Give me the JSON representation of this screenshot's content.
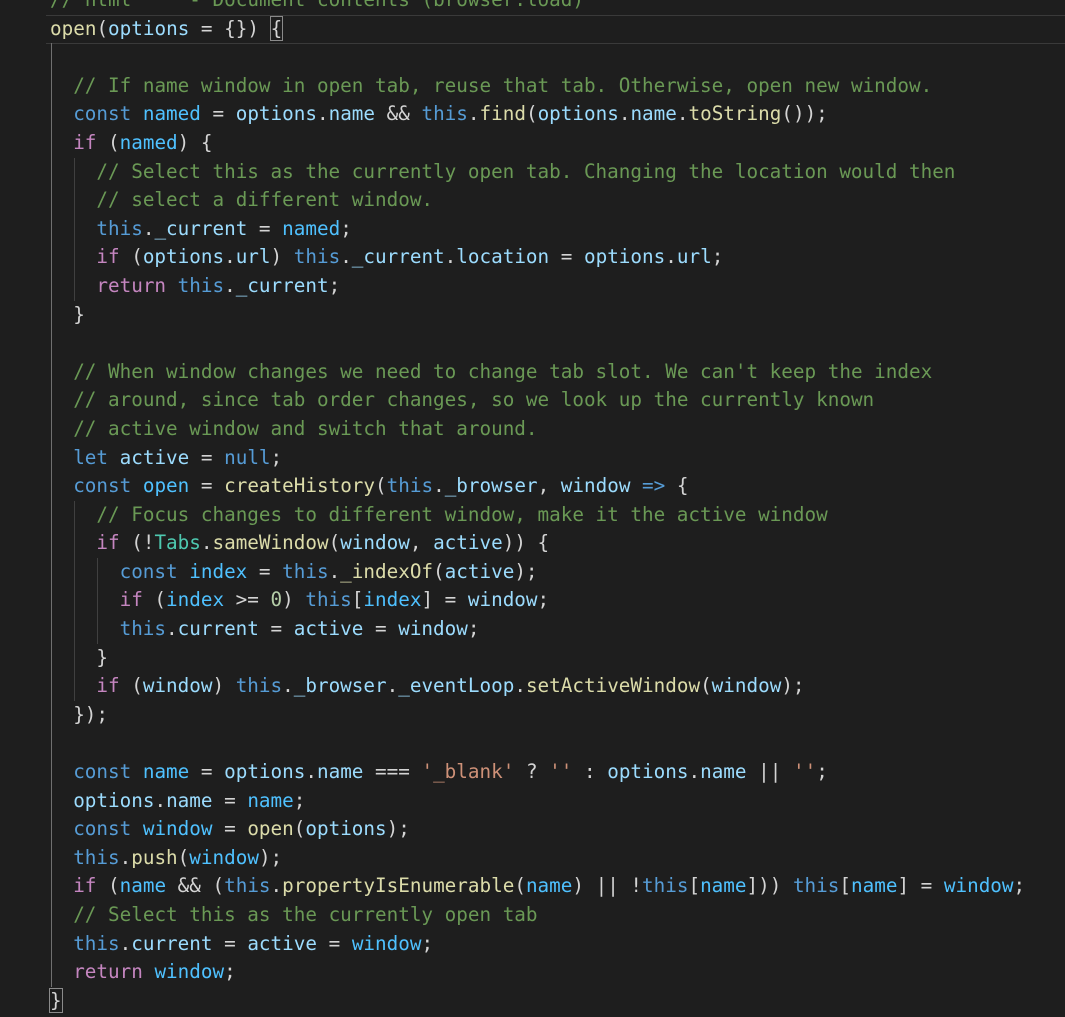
{
  "colors": {
    "background": "#1e1e1e",
    "default": "#d4d4d4",
    "comment": "#6a9955",
    "keyword": "#569cd6",
    "control": "#c586c0",
    "variable": "#9cdcfe",
    "function": "#dcdcaa",
    "string": "#ce9178",
    "number": "#b5cea8",
    "class": "#4ec9b0",
    "constant": "#4fc1ff"
  },
  "code": {
    "lines": [
      {
        "indent": 0,
        "tokens": [
          [
            "c",
            "// html     - Document contents (browser.load)"
          ]
        ]
      },
      {
        "indent": 0,
        "tokens": [
          [
            "f",
            "open"
          ],
          [
            "d",
            "("
          ],
          [
            "v",
            "options"
          ],
          [
            "d",
            " = {}) "
          ],
          [
            "d",
            "{"
          ]
        ]
      },
      {
        "indent": 1,
        "tokens": []
      },
      {
        "indent": 1,
        "tokens": [
          [
            "c",
            "// If name window in open tab, reuse that tab. Otherwise, open new window."
          ]
        ]
      },
      {
        "indent": 1,
        "tokens": [
          [
            "k",
            "const"
          ],
          [
            "d",
            " "
          ],
          [
            "n",
            "named"
          ],
          [
            "d",
            " = "
          ],
          [
            "v",
            "options"
          ],
          [
            "d",
            "."
          ],
          [
            "v",
            "name"
          ],
          [
            "d",
            " && "
          ],
          [
            "k",
            "this"
          ],
          [
            "d",
            "."
          ],
          [
            "f",
            "find"
          ],
          [
            "d",
            "("
          ],
          [
            "v",
            "options"
          ],
          [
            "d",
            "."
          ],
          [
            "v",
            "name"
          ],
          [
            "d",
            "."
          ],
          [
            "f",
            "toString"
          ],
          [
            "d",
            "());"
          ]
        ]
      },
      {
        "indent": 1,
        "tokens": [
          [
            "p",
            "if"
          ],
          [
            "d",
            " ("
          ],
          [
            "n",
            "named"
          ],
          [
            "d",
            ") {"
          ]
        ]
      },
      {
        "indent": 2,
        "tokens": [
          [
            "c",
            "// Select this as the currently open tab. Changing the location would then"
          ]
        ]
      },
      {
        "indent": 2,
        "tokens": [
          [
            "c",
            "// select a different window."
          ]
        ]
      },
      {
        "indent": 2,
        "tokens": [
          [
            "k",
            "this"
          ],
          [
            "d",
            "."
          ],
          [
            "v",
            "_current"
          ],
          [
            "d",
            " = "
          ],
          [
            "n",
            "named"
          ],
          [
            "d",
            ";"
          ]
        ]
      },
      {
        "indent": 2,
        "tokens": [
          [
            "p",
            "if"
          ],
          [
            "d",
            " ("
          ],
          [
            "v",
            "options"
          ],
          [
            "d",
            "."
          ],
          [
            "v",
            "url"
          ],
          [
            "d",
            ") "
          ],
          [
            "k",
            "this"
          ],
          [
            "d",
            "."
          ],
          [
            "v",
            "_current"
          ],
          [
            "d",
            "."
          ],
          [
            "v",
            "location"
          ],
          [
            "d",
            " = "
          ],
          [
            "v",
            "options"
          ],
          [
            "d",
            "."
          ],
          [
            "v",
            "url"
          ],
          [
            "d",
            ";"
          ]
        ]
      },
      {
        "indent": 2,
        "tokens": [
          [
            "p",
            "return"
          ],
          [
            "d",
            " "
          ],
          [
            "k",
            "this"
          ],
          [
            "d",
            "."
          ],
          [
            "v",
            "_current"
          ],
          [
            "d",
            ";"
          ]
        ]
      },
      {
        "indent": 1,
        "tokens": [
          [
            "d",
            "}"
          ]
        ]
      },
      {
        "indent": 1,
        "tokens": []
      },
      {
        "indent": 1,
        "tokens": [
          [
            "c",
            "// When window changes we need to change tab slot. We can't keep the index"
          ]
        ]
      },
      {
        "indent": 1,
        "tokens": [
          [
            "c",
            "// around, since tab order changes, so we look up the currently known"
          ]
        ]
      },
      {
        "indent": 1,
        "tokens": [
          [
            "c",
            "// active window and switch that around."
          ]
        ]
      },
      {
        "indent": 1,
        "tokens": [
          [
            "k",
            "let"
          ],
          [
            "d",
            " "
          ],
          [
            "v",
            "active"
          ],
          [
            "d",
            " = "
          ],
          [
            "k",
            "null"
          ],
          [
            "d",
            ";"
          ]
        ]
      },
      {
        "indent": 1,
        "tokens": [
          [
            "k",
            "const"
          ],
          [
            "d",
            " "
          ],
          [
            "n",
            "open"
          ],
          [
            "d",
            " = "
          ],
          [
            "f",
            "createHistory"
          ],
          [
            "d",
            "("
          ],
          [
            "k",
            "this"
          ],
          [
            "d",
            "."
          ],
          [
            "v",
            "_browser"
          ],
          [
            "d",
            ", "
          ],
          [
            "v",
            "window"
          ],
          [
            "d",
            " "
          ],
          [
            "k",
            "=>"
          ],
          [
            "d",
            " {"
          ]
        ]
      },
      {
        "indent": 2,
        "tokens": [
          [
            "c",
            "// Focus changes to different window, make it the active window"
          ]
        ]
      },
      {
        "indent": 2,
        "tokens": [
          [
            "p",
            "if"
          ],
          [
            "d",
            " (!"
          ],
          [
            "t",
            "Tabs"
          ],
          [
            "d",
            "."
          ],
          [
            "f",
            "sameWindow"
          ],
          [
            "d",
            "("
          ],
          [
            "v",
            "window"
          ],
          [
            "d",
            ", "
          ],
          [
            "v",
            "active"
          ],
          [
            "d",
            ")) {"
          ]
        ]
      },
      {
        "indent": 3,
        "tokens": [
          [
            "k",
            "const"
          ],
          [
            "d",
            " "
          ],
          [
            "n",
            "index"
          ],
          [
            "d",
            " = "
          ],
          [
            "k",
            "this"
          ],
          [
            "d",
            "."
          ],
          [
            "f",
            "_indexOf"
          ],
          [
            "d",
            "("
          ],
          [
            "v",
            "active"
          ],
          [
            "d",
            ");"
          ]
        ]
      },
      {
        "indent": 3,
        "tokens": [
          [
            "p",
            "if"
          ],
          [
            "d",
            " ("
          ],
          [
            "n",
            "index"
          ],
          [
            "d",
            " >= "
          ],
          [
            "num",
            "0"
          ],
          [
            "d",
            ") "
          ],
          [
            "k",
            "this"
          ],
          [
            "d",
            "["
          ],
          [
            "n",
            "index"
          ],
          [
            "d",
            "] = "
          ],
          [
            "v",
            "window"
          ],
          [
            "d",
            ";"
          ]
        ]
      },
      {
        "indent": 3,
        "tokens": [
          [
            "k",
            "this"
          ],
          [
            "d",
            "."
          ],
          [
            "v",
            "current"
          ],
          [
            "d",
            " = "
          ],
          [
            "v",
            "active"
          ],
          [
            "d",
            " = "
          ],
          [
            "v",
            "window"
          ],
          [
            "d",
            ";"
          ]
        ]
      },
      {
        "indent": 2,
        "tokens": [
          [
            "d",
            "}"
          ]
        ]
      },
      {
        "indent": 2,
        "tokens": [
          [
            "p",
            "if"
          ],
          [
            "d",
            " ("
          ],
          [
            "v",
            "window"
          ],
          [
            "d",
            ") "
          ],
          [
            "k",
            "this"
          ],
          [
            "d",
            "."
          ],
          [
            "v",
            "_browser"
          ],
          [
            "d",
            "."
          ],
          [
            "v",
            "_eventLoop"
          ],
          [
            "d",
            "."
          ],
          [
            "f",
            "setActiveWindow"
          ],
          [
            "d",
            "("
          ],
          [
            "v",
            "window"
          ],
          [
            "d",
            ");"
          ]
        ]
      },
      {
        "indent": 1,
        "tokens": [
          [
            "d",
            "});"
          ]
        ]
      },
      {
        "indent": 1,
        "tokens": []
      },
      {
        "indent": 1,
        "tokens": [
          [
            "k",
            "const"
          ],
          [
            "d",
            " "
          ],
          [
            "n",
            "name"
          ],
          [
            "d",
            " = "
          ],
          [
            "v",
            "options"
          ],
          [
            "d",
            "."
          ],
          [
            "v",
            "name"
          ],
          [
            "d",
            " === "
          ],
          [
            "s",
            "'_blank'"
          ],
          [
            "d",
            " ? "
          ],
          [
            "s",
            "''"
          ],
          [
            "d",
            " : "
          ],
          [
            "v",
            "options"
          ],
          [
            "d",
            "."
          ],
          [
            "v",
            "name"
          ],
          [
            "d",
            " || "
          ],
          [
            "s",
            "''"
          ],
          [
            "d",
            ";"
          ]
        ]
      },
      {
        "indent": 1,
        "tokens": [
          [
            "v",
            "options"
          ],
          [
            "d",
            "."
          ],
          [
            "v",
            "name"
          ],
          [
            "d",
            " = "
          ],
          [
            "n",
            "name"
          ],
          [
            "d",
            ";"
          ]
        ]
      },
      {
        "indent": 1,
        "tokens": [
          [
            "k",
            "const"
          ],
          [
            "d",
            " "
          ],
          [
            "n",
            "window"
          ],
          [
            "d",
            " = "
          ],
          [
            "f",
            "open"
          ],
          [
            "d",
            "("
          ],
          [
            "v",
            "options"
          ],
          [
            "d",
            ");"
          ]
        ]
      },
      {
        "indent": 1,
        "tokens": [
          [
            "k",
            "this"
          ],
          [
            "d",
            "."
          ],
          [
            "f",
            "push"
          ],
          [
            "d",
            "("
          ],
          [
            "n",
            "window"
          ],
          [
            "d",
            ");"
          ]
        ]
      },
      {
        "indent": 1,
        "tokens": [
          [
            "p",
            "if"
          ],
          [
            "d",
            " ("
          ],
          [
            "n",
            "name"
          ],
          [
            "d",
            " && ("
          ],
          [
            "k",
            "this"
          ],
          [
            "d",
            "."
          ],
          [
            "f",
            "propertyIsEnumerable"
          ],
          [
            "d",
            "("
          ],
          [
            "n",
            "name"
          ],
          [
            "d",
            ") || !"
          ],
          [
            "k",
            "this"
          ],
          [
            "d",
            "["
          ],
          [
            "n",
            "name"
          ],
          [
            "d",
            "])) "
          ],
          [
            "k",
            "this"
          ],
          [
            "d",
            "["
          ],
          [
            "n",
            "name"
          ],
          [
            "d",
            "] = "
          ],
          [
            "n",
            "window"
          ],
          [
            "d",
            ";"
          ]
        ]
      },
      {
        "indent": 1,
        "tokens": [
          [
            "c",
            "// Select this as the currently open tab"
          ]
        ]
      },
      {
        "indent": 1,
        "tokens": [
          [
            "k",
            "this"
          ],
          [
            "d",
            "."
          ],
          [
            "v",
            "current"
          ],
          [
            "d",
            " = "
          ],
          [
            "v",
            "active"
          ],
          [
            "d",
            " = "
          ],
          [
            "n",
            "window"
          ],
          [
            "d",
            ";"
          ]
        ]
      },
      {
        "indent": 1,
        "tokens": [
          [
            "p",
            "return"
          ],
          [
            "d",
            " "
          ],
          [
            "n",
            "window"
          ],
          [
            "d",
            ";"
          ]
        ]
      },
      {
        "indent": 0,
        "tokens": [
          [
            "d",
            "}"
          ]
        ]
      }
    ]
  }
}
